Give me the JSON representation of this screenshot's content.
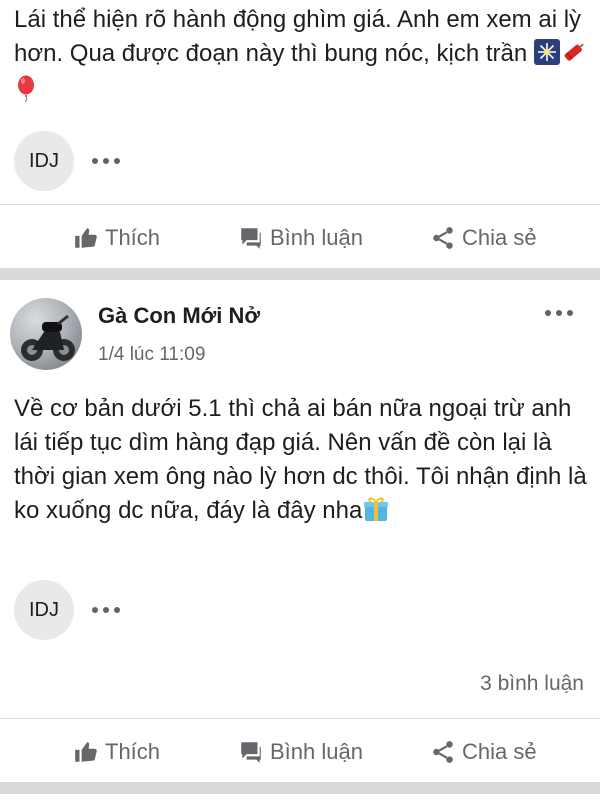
{
  "post1": {
    "text": "Lái thể hiện rõ hành động ghìm giá. Anh em xem ai lỳ hơn. Qua được đoạn này thì bung nóc, kịch trần",
    "emojis": [
      "sparkler-icon",
      "firecracker-icon",
      "balloon-icon"
    ],
    "chip_label": "IDJ"
  },
  "actions": {
    "like": "Thích",
    "comment": "Bình luận",
    "share": "Chia sẻ"
  },
  "post2": {
    "author": "Gà Con Mới Nở",
    "timestamp": "1/4 lúc 11:09",
    "text": "Về cơ bản dưới 5.1 thì chả ai bán nữa ngoại trừ anh lái tiếp tục dìm hàng đạp giá. Nên vấn đề còn lại là thời gian xem ông nào lỳ hơn dc thôi. Tôi nhận định là ko xuống dc nữa, đáy là đây nha",
    "emojis": [
      "gift-icon"
    ],
    "chip_label": "IDJ",
    "comment_count": "3 bình luận"
  }
}
